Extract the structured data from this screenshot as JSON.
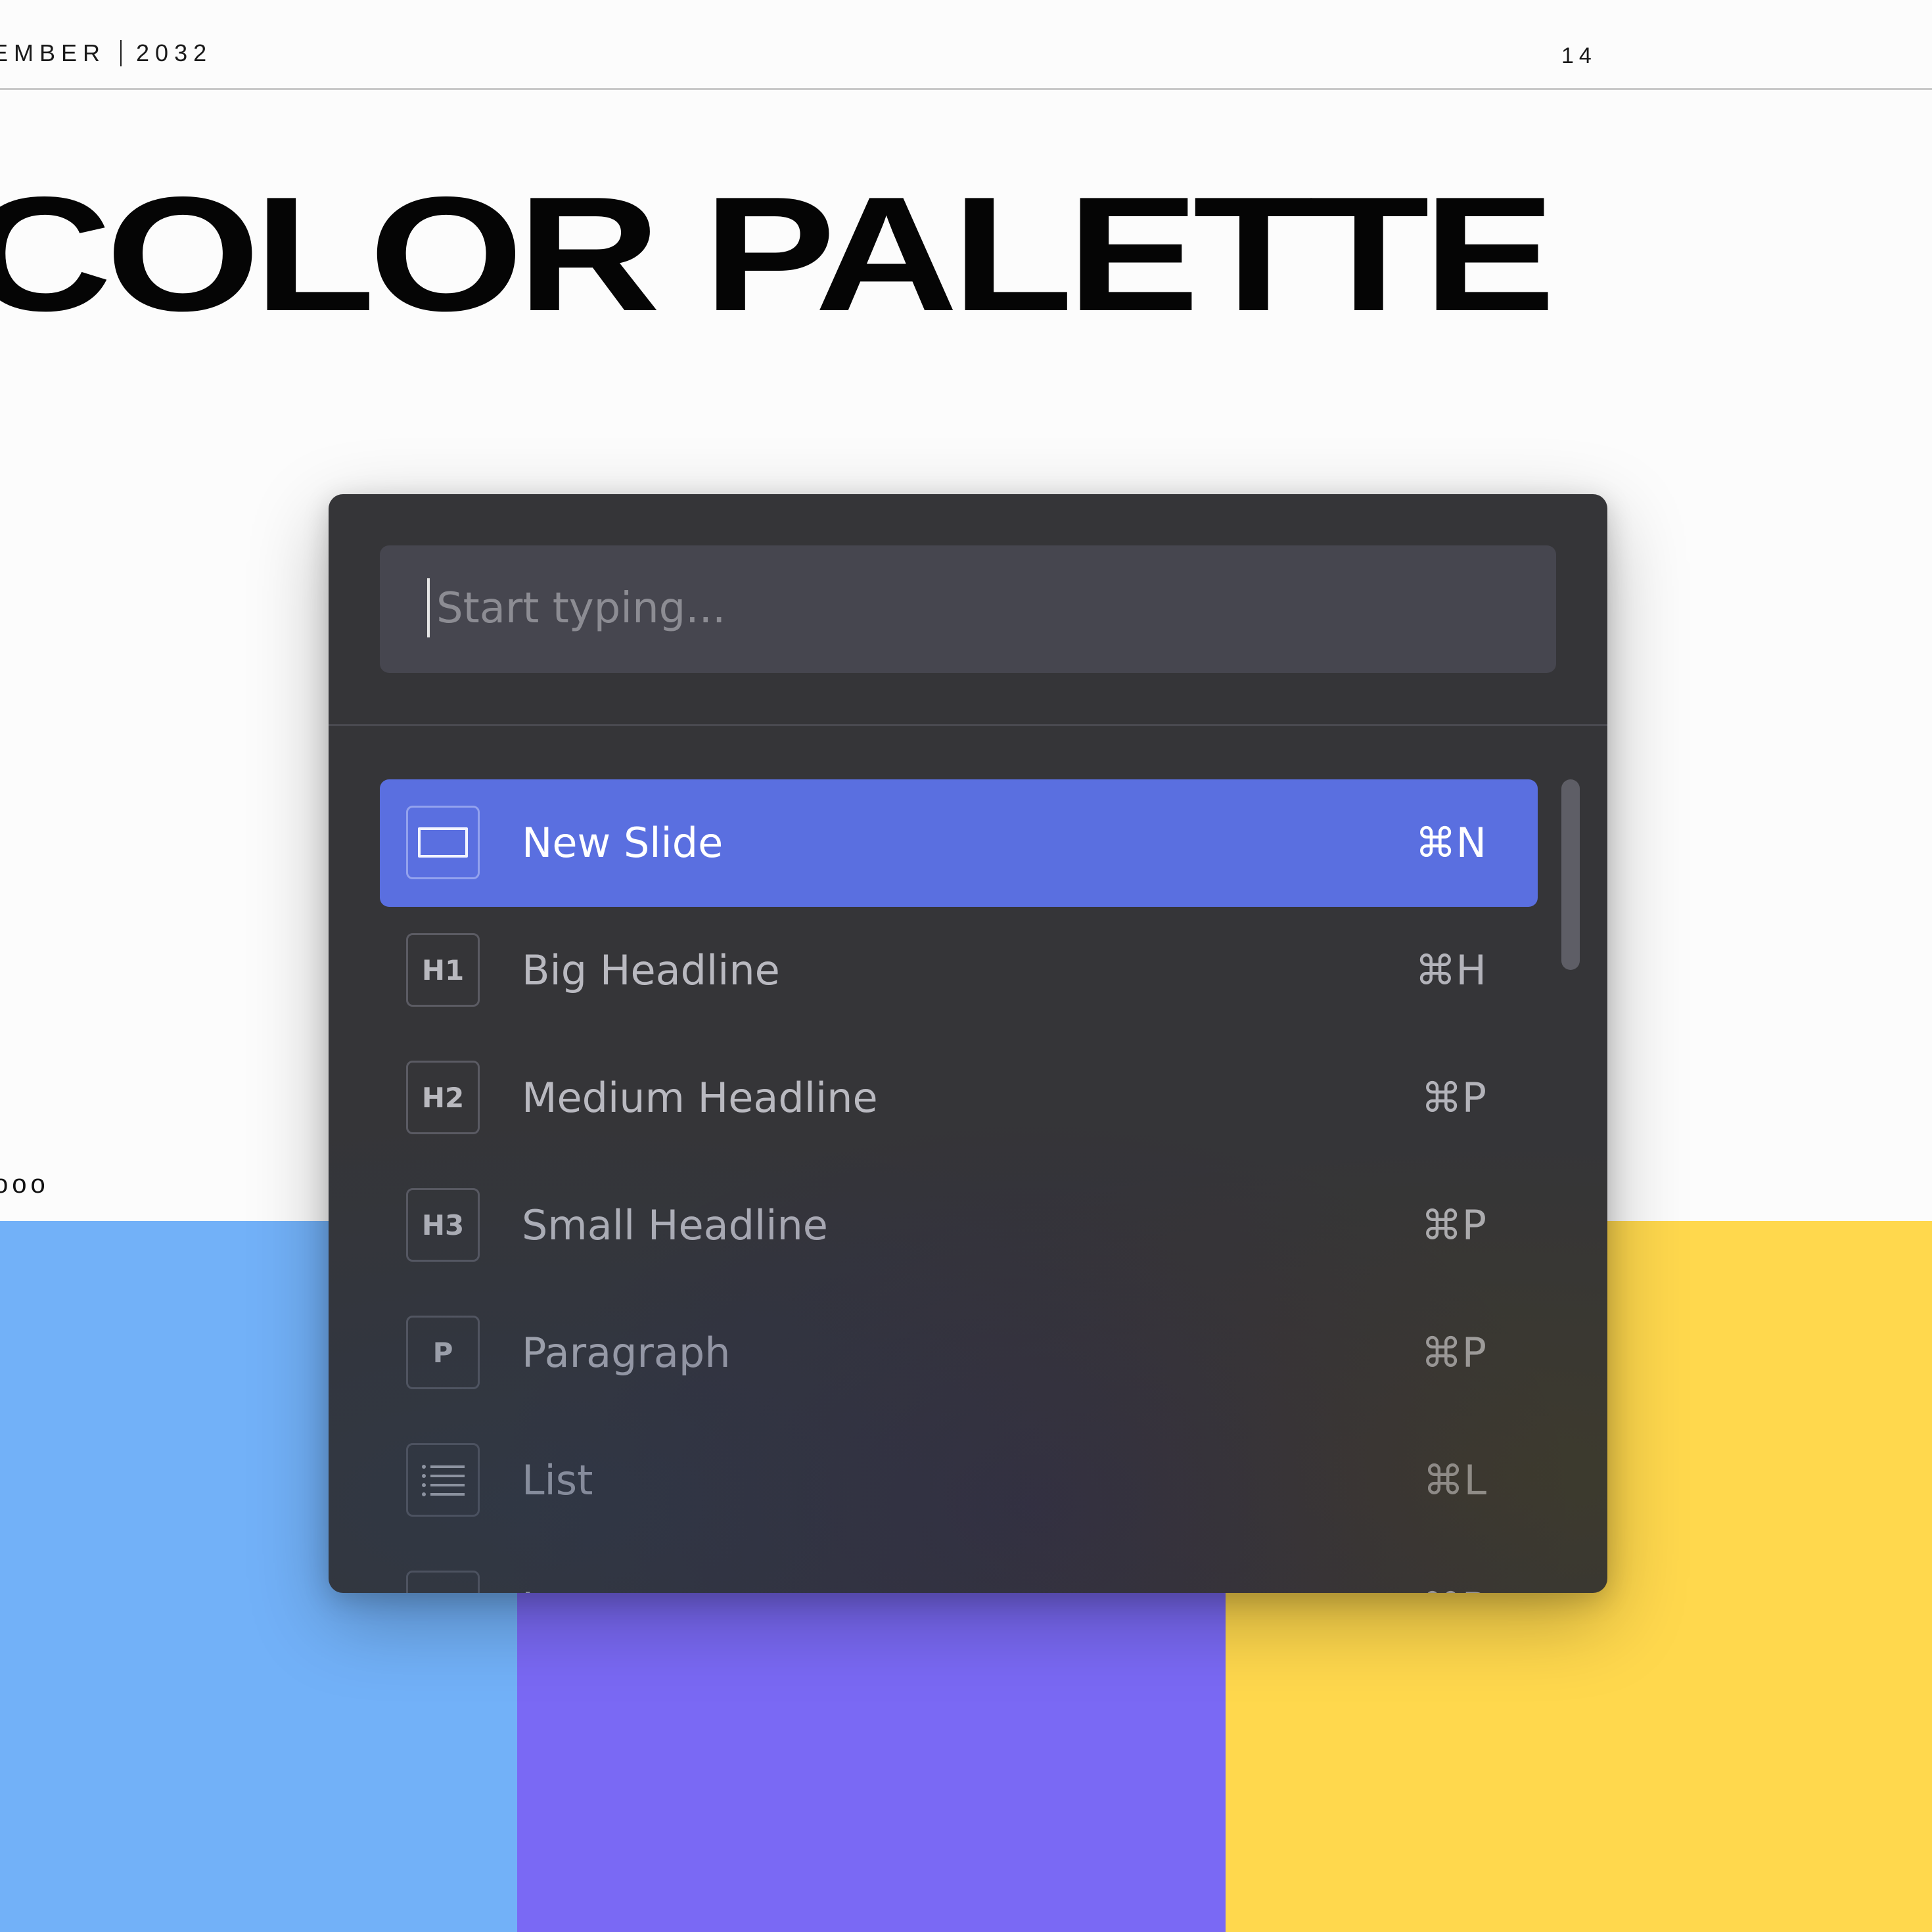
{
  "slide": {
    "header_date": "EMBER",
    "header_year": "2032",
    "page_number": "14",
    "title": "COLOR PALETTE",
    "dots": "ooo"
  },
  "swatches": [
    {
      "name": "blue",
      "color": "#72b1f8"
    },
    {
      "name": "purple",
      "color": "#7a69f4"
    },
    {
      "name": "yellow",
      "color": "#ffd84d"
    }
  ],
  "palette": {
    "search": {
      "value": "",
      "placeholder": "Start typing..."
    },
    "items": [
      {
        "icon": "slide-icon",
        "icon_text": "",
        "label": "New Slide",
        "shortcut": "⌘N",
        "selected": true
      },
      {
        "icon": "h1-icon",
        "icon_text": "H1",
        "label": "Big Headline",
        "shortcut": "⌘H",
        "selected": false
      },
      {
        "icon": "h2-icon",
        "icon_text": "H2",
        "label": "Medium Headline",
        "shortcut": "⌘P",
        "selected": false
      },
      {
        "icon": "h3-icon",
        "icon_text": "H3",
        "label": "Small Headline",
        "shortcut": "⌘P",
        "selected": false
      },
      {
        "icon": "paragraph-icon",
        "icon_text": "P",
        "label": "Paragraph",
        "shortcut": "⌘P",
        "selected": false
      },
      {
        "icon": "list-icon",
        "icon_text": "",
        "label": "List",
        "shortcut": "⌘L",
        "selected": false
      },
      {
        "icon": "image-icon",
        "icon_text": "",
        "label": "Image",
        "shortcut": "⌘P",
        "selected": false
      }
    ]
  }
}
